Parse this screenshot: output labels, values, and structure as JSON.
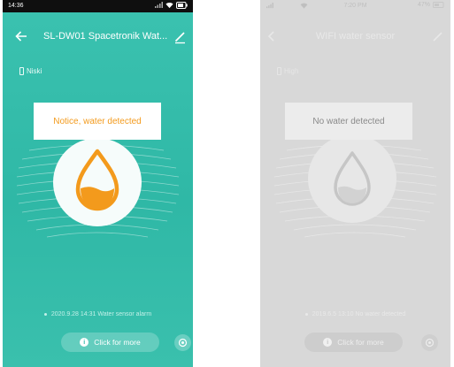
{
  "left_screen": {
    "status": {
      "time": "14:36"
    },
    "title": "SL-DW01 Spacetronik Wat...",
    "battery_label": "Niski",
    "notice": "Notice, water detected",
    "history": "2020.9.28 14:31 Water sensor alarm",
    "more_button": "Click for more",
    "colors": {
      "accent": "#f39a1c",
      "background": "#33bba9",
      "text": "#ffffff"
    },
    "icons": [
      "back-arrow-icon",
      "edit-pencil-icon",
      "battery-icon",
      "water-drop-icon",
      "info-icon",
      "settings-gear-icon"
    ]
  },
  "right_screen": {
    "status": {
      "time": "7:20 PM",
      "battery": "47%"
    },
    "title": "WIFI water sensor",
    "battery_label": "High",
    "notice": "No water detected",
    "history": "2019.6.5 13:10 No water detected",
    "more_button": "Click for more",
    "colors": {
      "background": "#d8d8d8",
      "text": "#b5b5b5"
    },
    "icons": [
      "back-arrow-icon",
      "edit-pencil-icon",
      "battery-icon",
      "water-drop-icon",
      "info-icon",
      "settings-gear-icon"
    ]
  }
}
